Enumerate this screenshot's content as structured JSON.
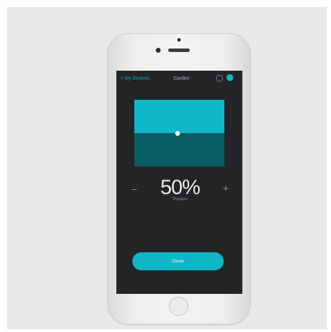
{
  "screen": {
    "back_label": "< My Devices",
    "title": "Garden",
    "info_icon": "info-icon",
    "power_icon": "power-icon",
    "level": {
      "value_percent": 50,
      "display": "50%",
      "subtext": "Position"
    },
    "stepper": {
      "minus_label": "−",
      "plus_label": "+"
    },
    "action_button_label": "Done"
  },
  "colors": {
    "accent": "#10b6c6",
    "screen_bg": "#222426",
    "level_bg": "#0a5e63"
  }
}
